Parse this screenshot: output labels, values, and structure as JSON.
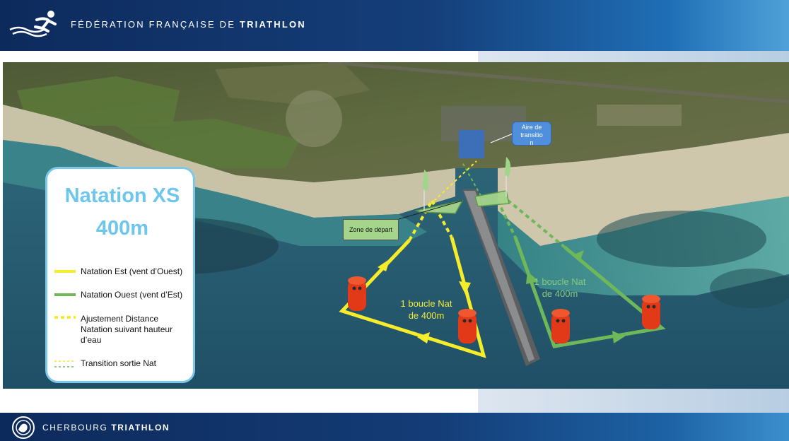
{
  "header": {
    "federation_prefix": "FÉDÉRATION FRANÇAISE DE",
    "federation_emphasis": "TRIATHLON"
  },
  "footer": {
    "club_prefix": "CHERBOURG",
    "club_emphasis": "TRIATHLON"
  },
  "legend": {
    "title_line1": "Natation XS",
    "title_line2": "400m",
    "items": [
      {
        "label": "Natation Est (vent d’Ouest)"
      },
      {
        "label": "Natation Ouest (vent d’Est)"
      },
      {
        "label": "Ajustement Distance Natation suivant hauteur d’eau"
      },
      {
        "label": "Transition sortie Nat"
      }
    ]
  },
  "map": {
    "zone_depart": "Zone de départ",
    "aire_transition_line1": "Aire de",
    "aire_transition_line2": "transitio",
    "aire_transition_line3": "n",
    "boucle_est_line1": "1 boucle Nat",
    "boucle_est_line2": "de 400m",
    "boucle_ouest_line1": "1 boucle Nat",
    "boucle_ouest_line2": "de 400m"
  },
  "colors": {
    "est_route": "#f5ec2a",
    "ouest_route": "#6fb85a",
    "buoy": "#e23a18",
    "legend_title": "#6ec6ec"
  },
  "icons": [
    "federation-logo",
    "club-logo",
    "buoy-icon",
    "flag-icon"
  ]
}
